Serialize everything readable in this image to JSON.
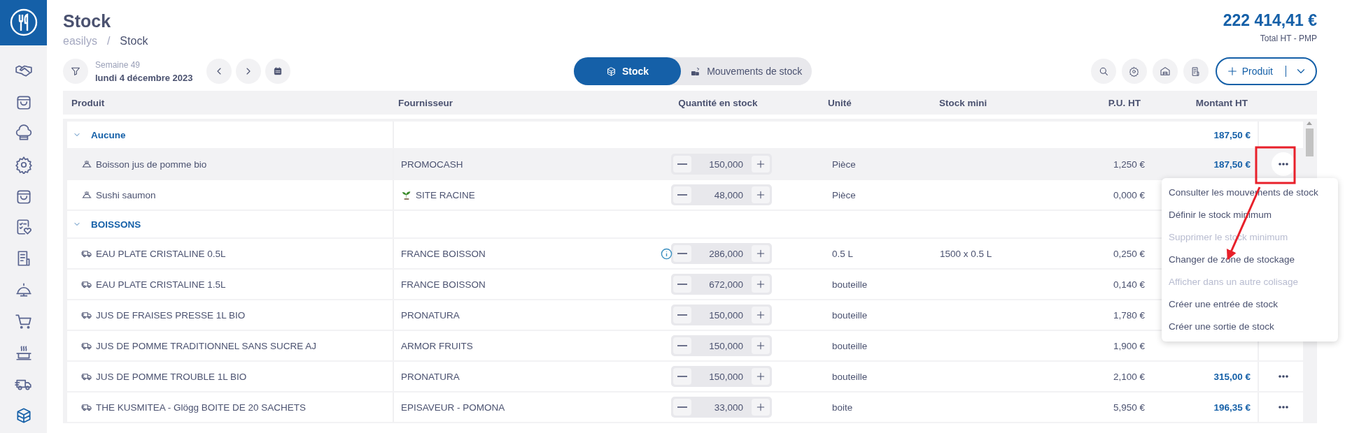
{
  "sidebar": {
    "items": [
      {
        "selected": false
      },
      {
        "selected": false
      },
      {
        "selected": false
      },
      {
        "selected": false
      },
      {
        "selected": false
      },
      {
        "selected": false
      },
      {
        "selected": false
      },
      {
        "selected": false
      },
      {
        "selected": false
      },
      {
        "selected": false
      },
      {
        "selected": false
      },
      {
        "selected": true
      }
    ]
  },
  "header": {
    "title": "Stock",
    "breadcrumb": [
      "easilys",
      "Stock"
    ],
    "breadcrumb_separator": "/",
    "total": "222 414,41 €",
    "total_label": "Total HT - PMP"
  },
  "period": {
    "week": "Semaine 49",
    "date": "lundi 4 décembre 2023"
  },
  "view_tabs": [
    {
      "label": "Stock",
      "selected": true
    },
    {
      "label": "Mouvements de stock",
      "selected": false
    }
  ],
  "add_button": {
    "label": "Produit"
  },
  "table": {
    "columns": [
      "Produit",
      "Fournisseur",
      "Quantité en stock",
      "Unité",
      "Stock mini",
      "P.U. HT",
      "Montant HT"
    ],
    "groups": [
      {
        "name": "Aucune",
        "expanded": true,
        "total": "187,50 €",
        "rows": [
          {
            "kind": "recipe",
            "product": "Boisson jus de pomme bio",
            "supplier": "PROMOCASH",
            "internal_supplier": false,
            "info": false,
            "quantity": "150,000",
            "unit": "Pièce",
            "unit_price": "1,250 €",
            "amount": "187,50 €",
            "highlighted": true
          },
          {
            "kind": "recipe",
            "product": "Sushi saumon",
            "supplier": "SITE RACINE",
            "internal_supplier": true,
            "info": false,
            "quantity": "48,000",
            "unit": "Pièce",
            "unit_price": "0,000 €",
            "highlighted": false
          }
        ]
      },
      {
        "name": "BOISSONS",
        "expanded": true,
        "rows": [
          {
            "kind": "purchased",
            "product": "EAU PLATE CRISTALINE 0.5L",
            "supplier": "FRANCE BOISSON",
            "internal_supplier": false,
            "info": true,
            "quantity": "286,000",
            "unit": "0.5 L",
            "stock_mini": "1500 x 0.5 L",
            "unit_price": "0,250 €",
            "highlighted": false
          },
          {
            "kind": "purchased",
            "product": "EAU PLATE CRISTALINE 1.5L",
            "supplier": "FRANCE BOISSON",
            "internal_supplier": false,
            "info": false,
            "quantity": "672,000",
            "unit": "bouteille",
            "unit_price": "0,140 €",
            "highlighted": false
          },
          {
            "kind": "purchased",
            "product": "JUS DE FRAISES PRESSE 1L BIO",
            "supplier": "PRONATURA",
            "internal_supplier": false,
            "info": false,
            "quantity": "150,000",
            "unit": "bouteille",
            "unit_price": "1,780 €",
            "highlighted": false
          },
          {
            "kind": "purchased",
            "product": "JUS DE POMME TRADITIONNEL SANS SUCRE AJ",
            "supplier": "ARMOR FRUITS",
            "internal_supplier": false,
            "info": false,
            "quantity": "150,000",
            "unit": "bouteille",
            "unit_price": "1,900 €",
            "highlighted": false
          },
          {
            "kind": "purchased",
            "product": "JUS DE POMME TROUBLE 1L BIO",
            "supplier": "PRONATURA",
            "internal_supplier": false,
            "info": false,
            "quantity": "150,000",
            "unit": "bouteille",
            "unit_price": "2,100 €",
            "amount": "315,00 €",
            "highlighted": false
          },
          {
            "kind": "purchased",
            "product": "THE KUSMITEA - Glögg BOITE DE 20 SACHETS",
            "supplier": "EPISAVEUR - POMONA",
            "internal_supplier": false,
            "info": false,
            "quantity": "33,000",
            "unit": "boite",
            "unit_price": "5,950 €",
            "amount": "196,35 €",
            "highlighted": false
          }
        ]
      }
    ]
  },
  "context_menu": {
    "items": [
      {
        "label": "Consulter les mouvements de stock",
        "disabled": false
      },
      {
        "label": "Définir le stock minimum",
        "disabled": false
      },
      {
        "label": "Supprimer le stock minimum",
        "disabled": true
      },
      {
        "label": "Changer de zone de stockage",
        "disabled": false
      },
      {
        "label": "Afficher dans un autre colisage",
        "disabled": true
      },
      {
        "label": "Créer une entrée de stock",
        "disabled": false
      },
      {
        "label": "Créer une sortie de stock",
        "disabled": false
      }
    ]
  }
}
